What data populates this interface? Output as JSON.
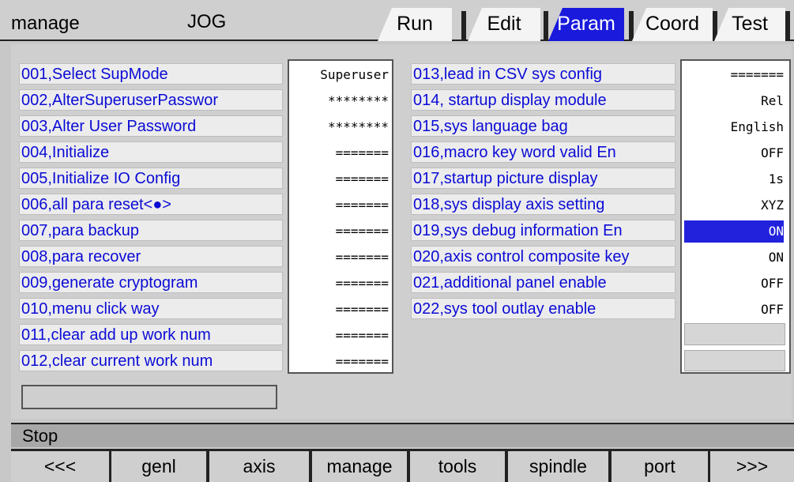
{
  "header": {
    "title": "manage",
    "mode": "JOG",
    "tabs": [
      "Run",
      "Edit",
      "Param",
      "Coord",
      "Test"
    ],
    "active_tab": "Param"
  },
  "params_left": [
    {
      "label": "001,Select SupMode",
      "value": "Superuser"
    },
    {
      "label": "002,AlterSuperuserPasswor",
      "value": "********"
    },
    {
      "label": "003,Alter User Password",
      "value": "********"
    },
    {
      "label": "004,Initialize",
      "value": "======="
    },
    {
      "label": "005,Initialize IO Config",
      "value": "======="
    },
    {
      "label": "006,all para reset<●>",
      "value": "======="
    },
    {
      "label": "007,para backup",
      "value": "======="
    },
    {
      "label": "008,para recover",
      "value": "======="
    },
    {
      "label": "009,generate cryptogram",
      "value": "======="
    },
    {
      "label": "010,menu click way",
      "value": "======="
    },
    {
      "label": "011,clear add up work num",
      "value": "======="
    },
    {
      "label": "012,clear current work num",
      "value": "======="
    }
  ],
  "params_right": [
    {
      "label": "013,lead in CSV sys config",
      "value": "======="
    },
    {
      "label": "014, startup display module",
      "value": "Rel"
    },
    {
      "label": "015,sys language bag",
      "value": "English"
    },
    {
      "label": "016,macro key word valid En",
      "value": "OFF"
    },
    {
      "label": "017,startup picture display",
      "value": "1s"
    },
    {
      "label": "018,sys display axis setting",
      "value": "XYZ"
    },
    {
      "label": "019,sys debug information En",
      "value": "ON",
      "selected": true
    },
    {
      "label": "020,axis control composite key",
      "value": "ON"
    },
    {
      "label": "021,additional panel enable",
      "value": "OFF"
    },
    {
      "label": "022,sys tool outlay enable",
      "value": "OFF"
    }
  ],
  "status": "Stop",
  "function_keys": [
    "<<<",
    "genl",
    "axis",
    "manage",
    "tools",
    "spindle",
    "port",
    ">>>"
  ],
  "colors": {
    "active_tab": "#1a1adc",
    "label_text": "#0b0bd6",
    "selected_value": "#2222dd"
  }
}
